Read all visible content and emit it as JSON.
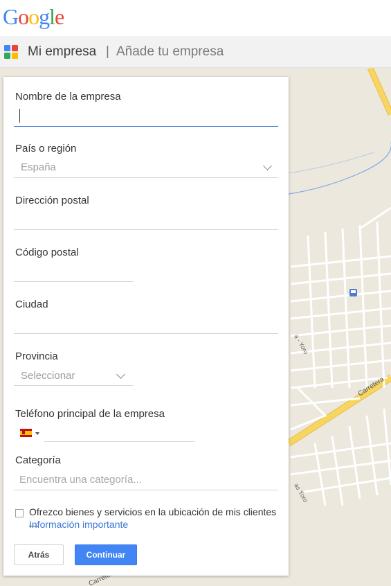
{
  "header": {
    "logo_letters": [
      {
        "ch": "G",
        "color": "#4285f4"
      },
      {
        "ch": "o",
        "color": "#ea4335"
      },
      {
        "ch": "o",
        "color": "#fbbc05"
      },
      {
        "ch": "g",
        "color": "#4285f4"
      },
      {
        "ch": "l",
        "color": "#34a853"
      },
      {
        "ch": "e",
        "color": "#ea4335"
      }
    ]
  },
  "subheader": {
    "icon": "google-my-business-icon",
    "title": "Mi empresa",
    "separator": "|",
    "subtitle": "Añade tu empresa"
  },
  "form": {
    "business_name": {
      "label": "Nombre de la empresa",
      "value": ""
    },
    "country": {
      "label": "País o región",
      "value": "España",
      "icon": "chevron-down-icon"
    },
    "address": {
      "label": "Dirección postal",
      "value": ""
    },
    "postal_code": {
      "label": "Código postal",
      "value": ""
    },
    "city": {
      "label": "Ciudad",
      "value": ""
    },
    "province": {
      "label": "Provincia",
      "value": "Seleccionar",
      "icon": "chevron-down-icon"
    },
    "phone": {
      "label": "Teléfono principal de la empresa",
      "country_flag": "spain-flag-icon",
      "value": ""
    },
    "category": {
      "label": "Categoría",
      "placeholder": "Encuentra una categoría..."
    },
    "service_area": {
      "checked": false,
      "text": "Ofrezco bienes y servicios en la ubicación de mis clientes —",
      "link": "Información importante"
    },
    "buttons": {
      "back": "Atrás",
      "continue": "Continuar"
    }
  },
  "map": {
    "road_labels": [
      "Carretera",
      "Carretera",
      "Carretera",
      "a - Yoro",
      "as Yoro"
    ],
    "colors": {
      "background": "#ece8de",
      "road": "#f7d560",
      "street": "#ffffff",
      "river": "#7fa9e6"
    }
  }
}
